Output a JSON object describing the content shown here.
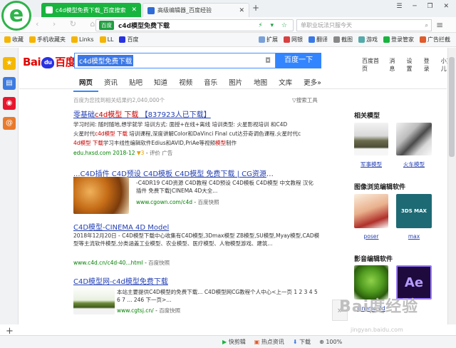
{
  "browser": {
    "logo_letter": "e",
    "tabs": [
      {
        "title": "c4d模型免费下载_百度搜索",
        "active": true
      },
      {
        "title": "高级编辑器_百度经验",
        "active": false
      }
    ],
    "new_tab": "+",
    "url_badge": "百度",
    "url_title": "c4d模型免费下载",
    "search_placeholder": "单职业玩法只服今天",
    "bookmarks": [
      "收藏",
      "手机收藏夹",
      "Links",
      "LL",
      "百度"
    ],
    "toolbar_items": [
      "扩展",
      "网银",
      "翻译",
      "截图",
      "游戏",
      "登录管家",
      "广告拦截"
    ],
    "colors": {
      "accent_green": "#18b43e",
      "baidu_blue": "#3385ff",
      "link_blue": "#2440b3",
      "hit_red": "#c00"
    }
  },
  "baidu": {
    "logo_left": "Bai",
    "logo_paw": "du",
    "logo_right": "百度",
    "query": "c4d模型免费下载",
    "search_button": "百度一下",
    "top_links": [
      "百度首页",
      "消息",
      "设置",
      "登录",
      "小艾儿"
    ],
    "tabs": [
      "网页",
      "资讯",
      "贴吧",
      "知道",
      "视频",
      "音乐",
      "图片",
      "地图",
      "文库",
      "更多»"
    ],
    "result_count": "百度为您找到相关结果约2,040,000个",
    "search_tools": "▽搜索工具"
  },
  "results": [
    {
      "title_pre": "零基础",
      "title_hit": "c4d模型 下载",
      "title_post": " 【837923人已下载】",
      "desc1": "学习时间: 随时随地,想学就学    培训方式: 面授+在线+离线    培训类型: 火星影视培训    和C4D",
      "desc2_pre": "火星时代",
      "desc2_hit": "c4d模型 下载",
      "desc2_post": " 培训课程,深度讲解Color和DaVinci Final cut达芬奇调色课程.火星时代c",
      "desc3_pre": "4d模型 下载",
      "desc3_post": "学习丰线性编辑软件Edius和AVID,PriAe等视频",
      "desc3_hit": "模型",
      "desc3_end": "制作",
      "url": "edu.hxsd.com",
      "date": "2018-12",
      "rating": "▼3",
      "eval": "评价",
      "ad": "广告"
    },
    {
      "title": "...C4D插件 C4D预设 C4D模板 C4D模型 免费下载 | CG资源网...",
      "desc": "-C4DR19 C4D资源 C4D教程 C4D预设 C4D模板 C4D模型 中文教程 汉化插件 免费下载|CINEMA 4D大全...",
      "url": "www.cgown.com/c4d",
      "snapshot": "百度快照"
    },
    {
      "title": "C4D模型-CINEMA 4D Model",
      "desc": "2018年12月20日 - C4D模型下载中心收集有C4D模型,3Dmax模型 ZB模型,SU模型,Myay模型,CAD模型等主流软件模型,分类涵盖工业模型、农业模型、医疗模型、人物模型游戏、建筑...",
      "url": "www.c4d.cn/c4d-40...html",
      "snapshot": "百度快照"
    },
    {
      "title": "C4D模型网-c4d模型免费下载",
      "desc": "本站主要提供C4D模型的免费下载... C4D模型网CG教程个人中心<上一页 1 2 3 4 5 6 7 ... 246 下一页>...",
      "url": "www.cgtsj.cn/",
      "snapshot": "百度快照"
    }
  ],
  "right": {
    "section1": "相关模型",
    "models": [
      "军事模型",
      "火车模型"
    ],
    "section2": "图像浏览编辑软件",
    "soft1": [
      "poser",
      "max",
      "3DS MAX"
    ],
    "section3": "影音编辑软件",
    "soft2": [
      "cinema 4d",
      "Ae"
    ]
  },
  "statusbar": {
    "items": [
      "快剪辑",
      "热点资讯",
      "下载",
      "100%"
    ]
  },
  "watermark": "Bai度经验",
  "watermark_sub": "jingyan.baidu.com"
}
